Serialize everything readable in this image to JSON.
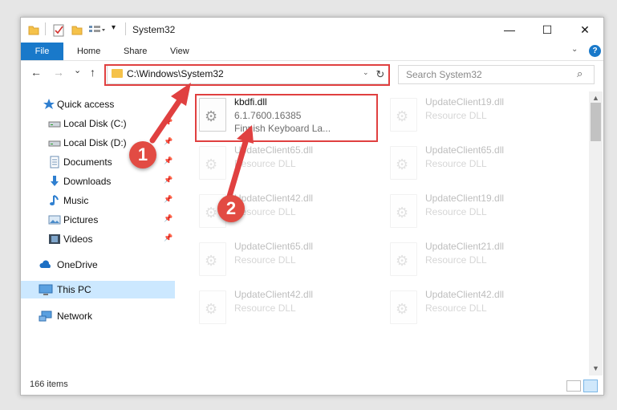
{
  "window": {
    "title": "System32"
  },
  "titlebar": {
    "minimize": "—",
    "maximize": "☐",
    "close": "✕",
    "qa_dropdown": "▾"
  },
  "ribbon": {
    "tabs": [
      "File",
      "Home",
      "Share",
      "View"
    ],
    "collapse_icon": "⌄",
    "help": "?"
  },
  "nav": {
    "back": "←",
    "forward": "→",
    "recent": "⌄",
    "up": "↑",
    "address": "C:\\Windows\\System32",
    "address_dropdown": "⌄",
    "refresh": "↻",
    "search_placeholder": "Search System32",
    "search_icon": "⌕"
  },
  "sidebar": {
    "items": [
      {
        "label": "Quick access",
        "icon": "star-icon"
      },
      {
        "label": "Local Disk (C:)",
        "icon": "drive-icon",
        "pinned": true
      },
      {
        "label": "Local Disk (D:)",
        "icon": "drive-icon",
        "pinned": true
      },
      {
        "label": "Documents",
        "icon": "documents-icon",
        "pinned": true
      },
      {
        "label": "Downloads",
        "icon": "download-icon",
        "pinned": true
      },
      {
        "label": "Music",
        "icon": "music-icon",
        "pinned": true
      },
      {
        "label": "Pictures",
        "icon": "pictures-icon",
        "pinned": true
      },
      {
        "label": "Videos",
        "icon": "videos-icon",
        "pinned": true
      },
      {
        "label": "OneDrive",
        "icon": "cloud-icon"
      },
      {
        "label": "This PC",
        "icon": "computer-icon",
        "selected": true
      },
      {
        "label": "Network",
        "icon": "network-icon"
      }
    ],
    "pin_glyph": "📌"
  },
  "files": [
    {
      "name": "kbdfi.dll",
      "line2": "6.1.7600.16385",
      "line3": "Finnish Keyboard La...",
      "highlighted": true
    },
    {
      "name": "UpdateClient19.dll",
      "line2": "Resource DLL"
    },
    {
      "name": "UpdateClient65.dll",
      "line2": "Resource DLL"
    },
    {
      "name": "UpdateClient65.dll",
      "line2": "Resource DLL"
    },
    {
      "name": "UpdateClient42.dll",
      "line2": "Resource DLL"
    },
    {
      "name": "UpdateClient19.dll",
      "line2": "Resource DLL"
    },
    {
      "name": "UpdateClient65.dll",
      "line2": "Resource DLL"
    },
    {
      "name": "UpdateClient21.dll",
      "line2": "Resource DLL"
    },
    {
      "name": "UpdateClient42.dll",
      "line2": "Resource DLL"
    },
    {
      "name": "UpdateClient42.dll",
      "line2": "Resource DLL"
    }
  ],
  "status": {
    "items": "166 items"
  },
  "annotations": {
    "badge1": "1",
    "badge2": "2",
    "accent": "#e04040"
  },
  "colors": {
    "accent_blue": "#1979ca",
    "folder_yellow": "#f5c24a",
    "selection": "#cce8ff"
  }
}
